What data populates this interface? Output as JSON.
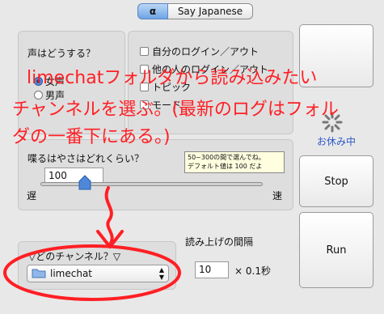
{
  "tabs": {
    "alpha": "α",
    "main": "Say Japanese"
  },
  "voice": {
    "title": "声はどうする？",
    "options": [
      "女声",
      "男声"
    ]
  },
  "options": {
    "items": [
      "自分のログイン／アウト",
      "他の人のログイン／アウト",
      "トピック",
      "モード"
    ]
  },
  "speed": {
    "title": "喋るはやさはどれくらい？",
    "value": "100",
    "tooltip": "50~300の間で選んでね。\nデフォルト値は 100 だよ",
    "slow": "遅",
    "fast": "速",
    "level": 0.2
  },
  "status": {
    "text": "お休み中"
  },
  "buttons": {
    "stop": "Stop",
    "run": "Run"
  },
  "channel": {
    "title": "▽どのチャンネル？▽",
    "selected": "limechat"
  },
  "interval": {
    "title": "読み上げの間隔",
    "value": "10",
    "unit": "× 0.1秒"
  },
  "annotation": {
    "line1": "limechatフォルダから読み込みたい",
    "line2": "チャンネルを選ぶ。(最新のログはフォル",
    "line3": "ダの一番下にある。)"
  },
  "colors": {
    "annotation": "#ff1f24",
    "accent": "#3b74c9"
  }
}
